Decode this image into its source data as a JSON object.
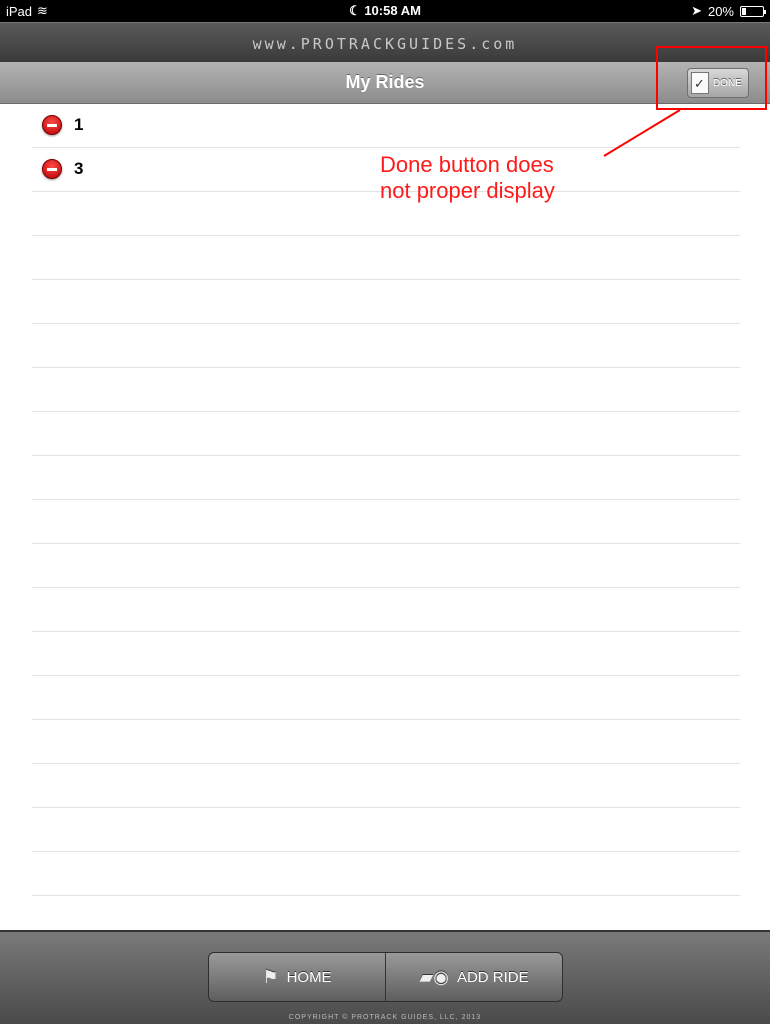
{
  "status": {
    "device": "iPad",
    "time": "☾ 10:58 AM",
    "battery_text": "20%",
    "battery_level": 0.2
  },
  "brand": {
    "text": "www.PROTRACKGUIDES.com"
  },
  "nav": {
    "title": "My Rides",
    "done_label": "DONE"
  },
  "rides": [
    {
      "label": "1"
    },
    {
      "label": "3"
    }
  ],
  "annotation": {
    "text_line1": "Done button does",
    "text_line2": "not proper display",
    "color": "#ff0000"
  },
  "tabs": {
    "home_label": "HOME",
    "add_ride_label": "ADD RIDE"
  },
  "footer": {
    "copyright": "COPYRIGHT © PROTRACK GUIDES, LLC, 2013"
  }
}
